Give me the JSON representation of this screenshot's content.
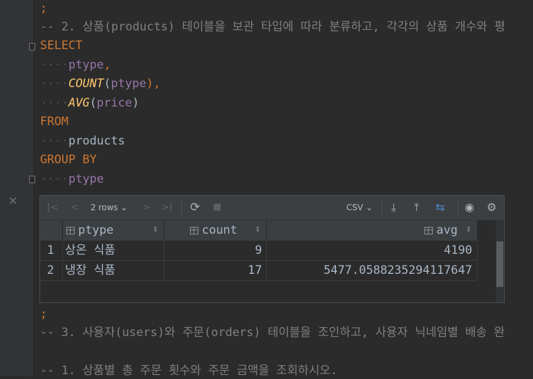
{
  "editor": {
    "lines": {
      "l0": ";",
      "l1": "-- 2. 상품(products) 테이블을 보관 타입에 따라 분류하고, 각각의 상품 개수와 평",
      "l2": "SELECT",
      "l3_col": "ptype",
      "l3_comma": ",",
      "l4_fn": "COUNT",
      "l4_open": "(",
      "l4_arg": "ptype",
      "l4_close": "),",
      "l5_fn": "AVG",
      "l5_open": "(",
      "l5_arg": "price",
      "l5_close": ")",
      "l6": "FROM",
      "l7": "products",
      "l8": "GROUP BY",
      "l9": "ptype",
      "l10": ";",
      "l11": "-- 3. 사용자(users)와 주문(orders) 테이블을 조인하고, 사용자 닉네임별 배송 완",
      "l12": "-- 1. 상품별 총 주문 횟수와 주문 금액을 조회하시오."
    },
    "indent": "····"
  },
  "result_panel": {
    "row_count_label": "2 rows",
    "export_format": "CSV",
    "columns": [
      "ptype",
      "count",
      "avg"
    ],
    "rows": [
      {
        "num": "1",
        "ptype": "상온 식품",
        "count": "9",
        "avg": "4190"
      },
      {
        "num": "2",
        "ptype": "냉장 식품",
        "count": "17",
        "avg": "5477.0588235294117647"
      }
    ],
    "icons": {
      "first": "|<",
      "prev": "<",
      "next": ">",
      "last": ">|",
      "dropdown": "⌄",
      "refresh": "⟳",
      "stop": "■",
      "download": "⤓",
      "upload": "⤒",
      "compare": "⇆",
      "view": "◉",
      "settings": "⚙",
      "sort": "⇕",
      "close": "✕"
    }
  }
}
